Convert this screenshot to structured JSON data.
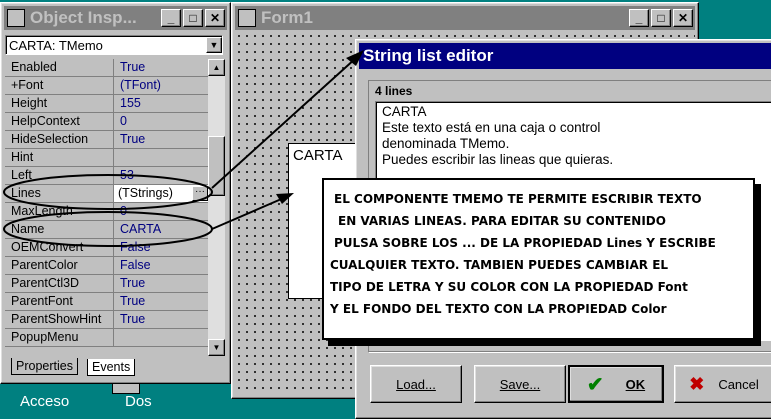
{
  "object_inspector": {
    "title": "Object Insp...",
    "component": "CARTA: TMemo",
    "properties": [
      {
        "name": "Enabled",
        "value": "True"
      },
      {
        "name": "+Font",
        "value": "(TFont)"
      },
      {
        "name": "Height",
        "value": "155"
      },
      {
        "name": "HelpContext",
        "value": "0"
      },
      {
        "name": "HideSelection",
        "value": "True"
      },
      {
        "name": "Hint",
        "value": ""
      },
      {
        "name": "Left",
        "value": "53"
      },
      {
        "name": "Lines",
        "value": "(TStrings)"
      },
      {
        "name": "MaxLength",
        "value": "0"
      },
      {
        "name": "Name",
        "value": "CARTA"
      },
      {
        "name": "OEMConvert",
        "value": "False"
      },
      {
        "name": "ParentColor",
        "value": "False"
      },
      {
        "name": "ParentCtl3D",
        "value": "True"
      },
      {
        "name": "ParentFont",
        "value": "True"
      },
      {
        "name": "ParentShowHint",
        "value": "True"
      },
      {
        "name": "PopupMenu",
        "value": ""
      }
    ],
    "tabs": {
      "properties": "Properties",
      "events": "Events"
    }
  },
  "form1": {
    "title": "Form1",
    "memo_text": "CARTA"
  },
  "string_editor": {
    "title": "String list editor",
    "line_count": "4 lines",
    "lines": [
      "CARTA",
      "Este texto está en una caja o control",
      "denominada TMemo.",
      "Puedes escribir las lineas que quieras."
    ],
    "buttons": {
      "load": "Load...",
      "save": "Save...",
      "ok": "OK",
      "cancel": "Cancel"
    }
  },
  "annotation": {
    "lines": [
      "EL COMPONENTE TMEMO TE PERMITE ESCRIBIR TEXTO",
      "EN VARIAS LINEAS. PARA EDITAR SU CONTENIDO",
      "PULSA SOBRE LOS ... DE LA PROPIEDAD Lines Y ESCRIBE",
      "CUALQUIER TEXTO.  TAMBIEN PUEDES CAMBIAR EL",
      "TIPO DE LETRA Y SU COLOR CON LA PROPIEDAD Font",
      "Y EL FONDO DEL TEXTO CON LA PROPIEDAD Color"
    ]
  },
  "desktop": {
    "icon1": "Acceso",
    "icon2": "Dos"
  },
  "colors": {
    "teal": "#008080",
    "title_active": "#000080",
    "title_inactive": "#808080",
    "face": "#c0c0c0",
    "value_blue": "#000080"
  }
}
